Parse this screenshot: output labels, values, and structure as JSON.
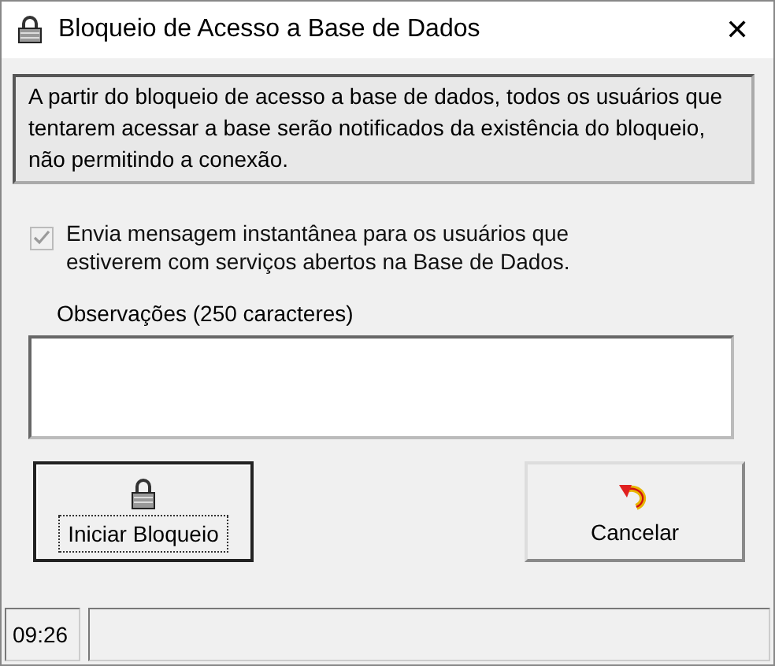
{
  "window": {
    "title": "Bloqueio de Acesso a Base de Dados",
    "close": "✕"
  },
  "info": "A partir do bloqueio de acesso a base de dados,  todos   os usuários que tentarem  acessar a  base serão notificados da existência  do bloqueio,  não  permitindo a conexão.",
  "notify": {
    "label": "Envia mensagem instantânea para os usuários que estiverem com serviços abertos na Base de Dados.",
    "checked": true,
    "disabled": true
  },
  "notes": {
    "label": "Observações (250 caracteres)"
  },
  "buttons": [
    {
      "label": "Iniciar Bloqueio",
      "kind": "lock",
      "focused": true
    },
    {
      "label": "Cancelar",
      "kind": "undo",
      "focused": false
    }
  ],
  "status_bar": {
    "time": "09:26"
  }
}
